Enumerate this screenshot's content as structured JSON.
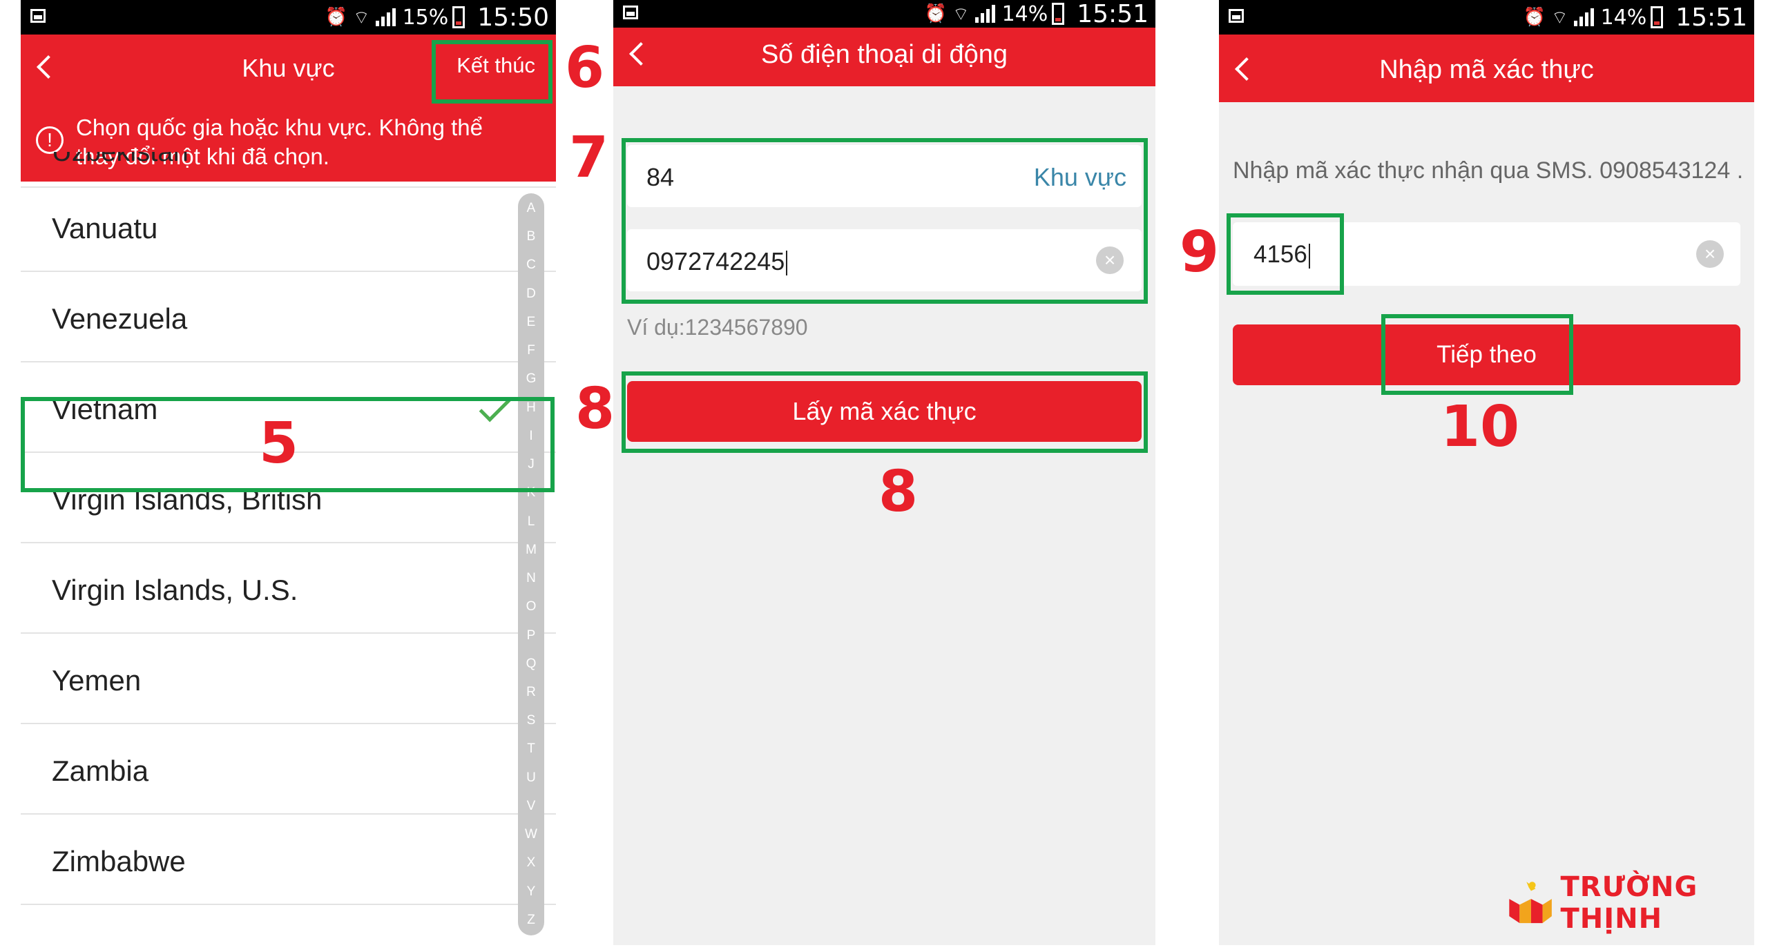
{
  "phone1": {
    "status": {
      "percent": "15%",
      "time": "15:50"
    },
    "title": "Khu vực",
    "done_label": "Kết thúc",
    "notice": "Chọn quốc gia hoặc khu vực. Không thể thay đổi một khi đã chọn.",
    "countries": [
      {
        "label": "Uzbekistan",
        "selected": false
      },
      {
        "label": "Vanuatu",
        "selected": false
      },
      {
        "label": "Venezuela",
        "selected": false
      },
      {
        "label": "Vietnam",
        "selected": true
      },
      {
        "label": "Virgin Islands, British",
        "selected": false
      },
      {
        "label": "Virgin Islands, U.S.",
        "selected": false
      },
      {
        "label": "Yemen",
        "selected": false
      },
      {
        "label": "Zambia",
        "selected": false
      },
      {
        "label": "Zimbabwe",
        "selected": false
      }
    ],
    "index": [
      "A",
      "B",
      "C",
      "D",
      "E",
      "F",
      "G",
      "H",
      "I",
      "J",
      "K",
      "L",
      "M",
      "N",
      "O",
      "P",
      "Q",
      "R",
      "S",
      "T",
      "U",
      "V",
      "W",
      "X",
      "Y",
      "Z"
    ]
  },
  "phone2": {
    "status": {
      "percent": "14%",
      "time": "15:51"
    },
    "title": "Số điện thoại di động",
    "country_code": "84",
    "region_label": "Khu vực",
    "phone_value": "0972742245",
    "hint": "Ví dụ:1234567890",
    "button_label": "Lấy mã xác thực"
  },
  "phone3": {
    "status": {
      "percent": "14%",
      "time": "15:51"
    },
    "title": "Nhập mã xác thực",
    "sms_text": "Nhập mã xác thực nhận qua SMS. 0908543124 .",
    "code_value": "4156",
    "button_label": "Tiếp theo"
  },
  "annotations": {
    "n5": "5",
    "n6": "6",
    "n7": "7",
    "n8a": "8",
    "n8b": "8",
    "n9": "9",
    "n10": "10"
  },
  "logo": {
    "text": "TRƯỜNG THỊNH"
  },
  "icons": {
    "back": "chevron-left-icon",
    "clear": "clear-icon",
    "check": "check-icon",
    "info": "info-icon"
  },
  "colors": {
    "brand_red": "#e8202a",
    "annotation_green": "#17a34a",
    "check_green": "#4caf50",
    "link_blue": "#3a86a8"
  }
}
